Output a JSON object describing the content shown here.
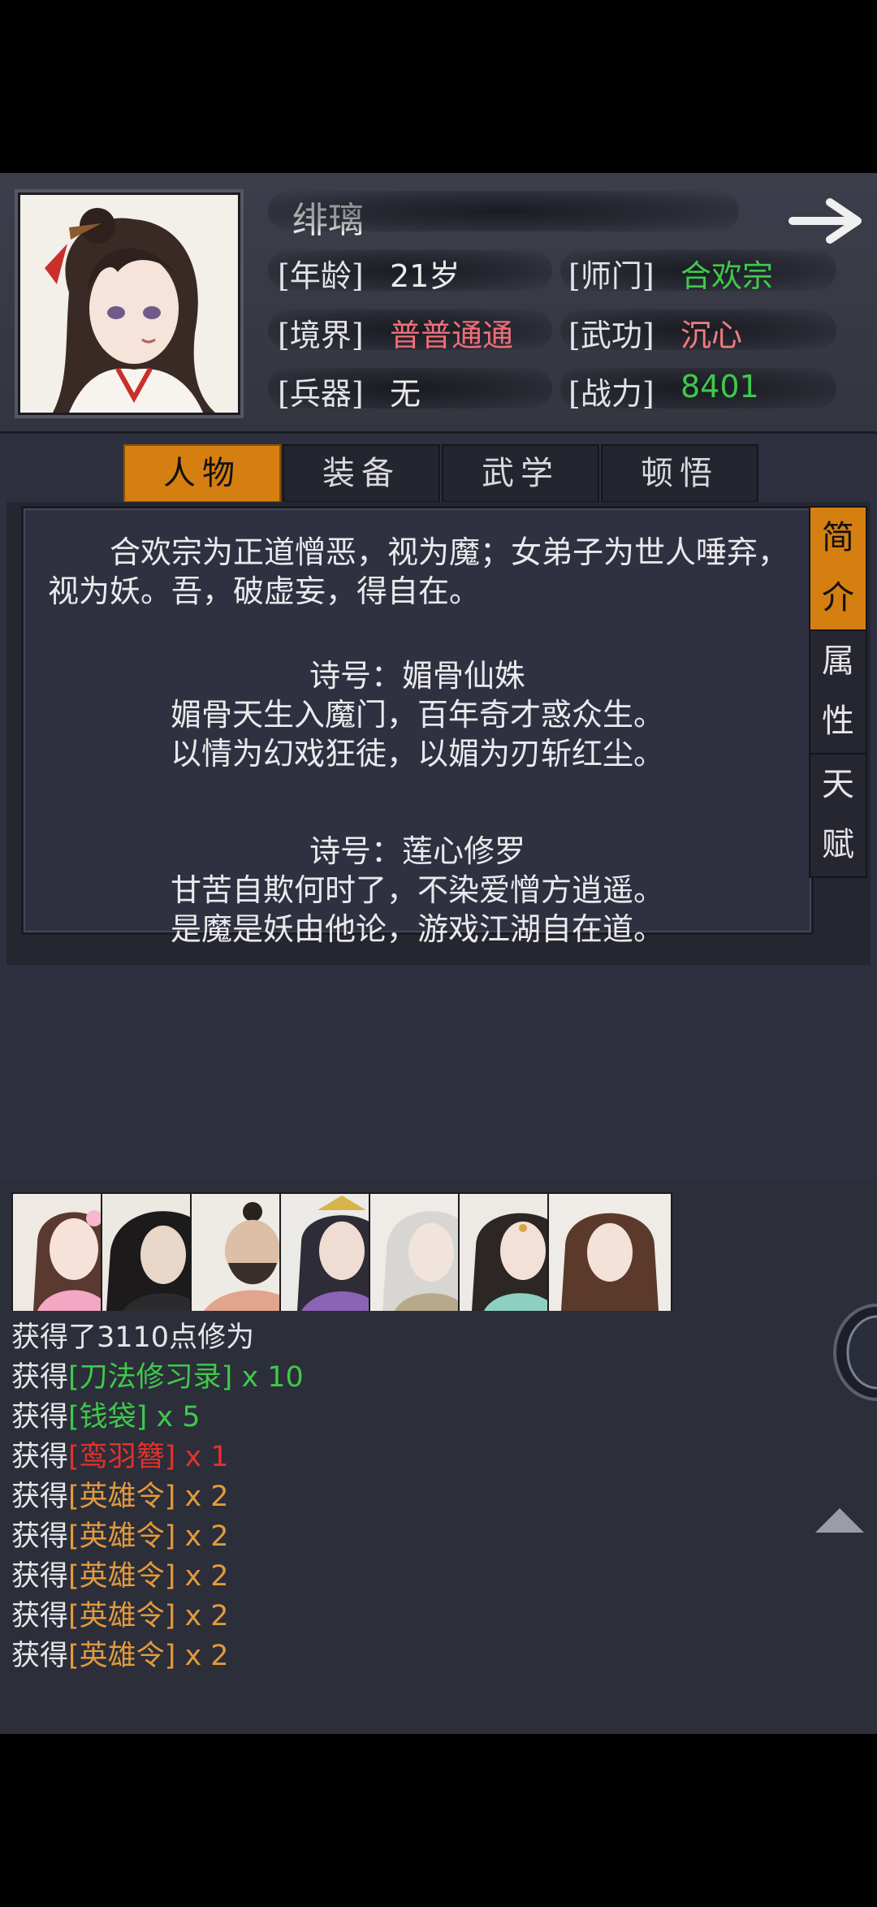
{
  "character": {
    "name": "绯璃",
    "fields": {
      "age_label": "[年龄]",
      "age_value": "21岁",
      "sect_label": "[师门]",
      "sect_value": "合欢宗",
      "realm_label": "[境界]",
      "realm_value": "普普通通",
      "skill_label": "[武功]",
      "skill_value": "沉心",
      "weapon_label": "[兵器]",
      "weapon_value": "无",
      "power_label": "[战力]",
      "power_value": "8401"
    }
  },
  "tabs": [
    "人物",
    "装备",
    "武学",
    "顿悟"
  ],
  "active_tab": 0,
  "side_tabs": [
    [
      "简",
      "介"
    ],
    [
      "属",
      "性"
    ],
    [
      "天",
      "赋"
    ]
  ],
  "intro": {
    "text": "合欢宗为正道憎恶，视为魔；女弟子为世人唾弃，视为妖。吾，破虚妄，得自在。",
    "poem1_title": "诗号：媚骨仙姝",
    "poem1_line1": "媚骨天生入魔门，百年奇才惑众生。",
    "poem1_line2": "以情为幻戏狂徒，以媚为刃斩红尘。",
    "poem2_title": "诗号：莲心修罗",
    "poem2_line1": "甘苦自欺何时了，不染爱憎方逍遥。",
    "poem2_line2": "是魔是妖由他论，游戏江湖自在道。"
  },
  "log": [
    {
      "prefix": "获得了3110点修为",
      "item": "",
      "suffix": "",
      "color": ""
    },
    {
      "prefix": "获得",
      "item": "[刀法修习录]",
      "suffix": " x 10",
      "color": "green"
    },
    {
      "prefix": "获得",
      "item": "[钱袋]",
      "suffix": " x 5",
      "color": "green"
    },
    {
      "prefix": "获得",
      "item": "[鸾羽簪]",
      "suffix": " x 1",
      "color": "red"
    },
    {
      "prefix": "获得",
      "item": "[英雄令]",
      "suffix": " x 2",
      "color": "orange"
    },
    {
      "prefix": "获得",
      "item": "[英雄令]",
      "suffix": " x 2",
      "color": "orange"
    },
    {
      "prefix": "获得",
      "item": "[英雄令]",
      "suffix": " x 2",
      "color": "orange"
    },
    {
      "prefix": "获得",
      "item": "[英雄令]",
      "suffix": " x 2",
      "color": "orange"
    },
    {
      "prefix": "获得",
      "item": "[英雄令]",
      "suffix": " x 2",
      "color": "orange"
    }
  ],
  "colors": {
    "accent": "#d57f10",
    "green": "#3ec94a",
    "red": "#e2322a",
    "pink": "#f07a80",
    "orange": "#e19a3c",
    "realm": "#ee6e78"
  },
  "icons": {
    "forward": "arrow-right-icon",
    "scroll_up": "triangle-up-icon"
  }
}
